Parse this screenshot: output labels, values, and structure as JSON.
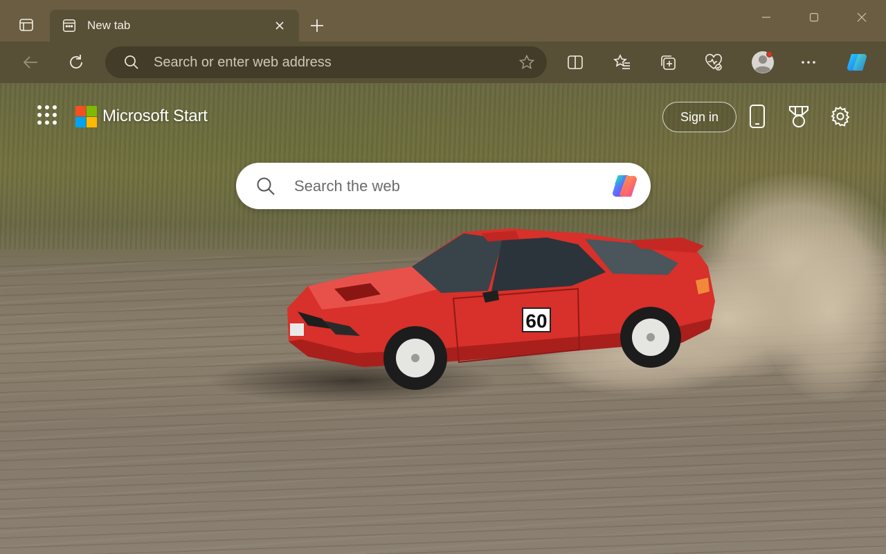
{
  "browser": {
    "tab": {
      "title": "New tab"
    },
    "address_bar": {
      "placeholder": "Search or enter web address",
      "value": ""
    }
  },
  "start_page": {
    "brand_name": "Microsoft Start",
    "sign_in_label": "Sign in",
    "search": {
      "placeholder": "Search the web"
    },
    "car_number": "60"
  },
  "icons": {
    "tab_actions": "tab-actions-icon",
    "favicon": "new-tab-page-icon",
    "close": "close-icon",
    "new_tab": "plus-icon",
    "minimize": "minimize-icon",
    "maximize": "maximize-icon",
    "window_close": "window-close-icon",
    "back": "back-arrow-icon",
    "refresh": "refresh-icon",
    "search": "search-icon",
    "favorite": "star-icon",
    "split_screen": "split-screen-icon",
    "favorites": "favorites-icon",
    "collections": "collections-icon",
    "browser_essentials": "heart-pulse-icon",
    "profile": "profile-avatar-icon",
    "more": "more-dots-icon",
    "copilot": "copilot-icon",
    "apps": "app-launcher-icon",
    "mobile": "phone-icon",
    "rewards": "rewards-trophy-icon",
    "settings": "gear-icon"
  },
  "colors": {
    "titlebar": "#6a5d42",
    "toolbar": "#585036",
    "omnibox": "#433c28",
    "ms_red": "#f25022",
    "ms_green": "#7fba00",
    "ms_blue": "#00a4ef",
    "ms_yellow": "#ffb900",
    "car_red": "#d8302a"
  }
}
